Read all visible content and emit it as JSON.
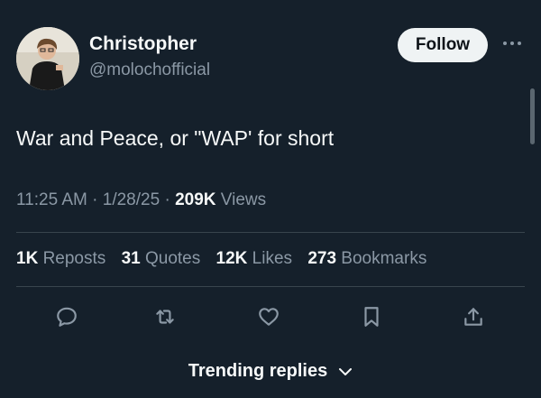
{
  "author": {
    "name": "Christopher",
    "handle": "@molochofficial",
    "follow_label": "Follow"
  },
  "tweet": {
    "text": "War and Peace, or \"WAP' for short",
    "time": "11:25 AM",
    "date": "1/28/25",
    "views_count": "209K",
    "views_label": "Views"
  },
  "stats": {
    "reposts_count": "1K",
    "reposts_label": "Reposts",
    "quotes_count": "31",
    "quotes_label": "Quotes",
    "likes_count": "12K",
    "likes_label": "Likes",
    "bookmarks_count": "273",
    "bookmarks_label": "Bookmarks"
  },
  "actions": [
    "reply-icon",
    "repost-icon",
    "like-icon",
    "bookmark-icon",
    "share-icon"
  ],
  "trending": {
    "label": "Trending replies"
  },
  "colors": {
    "background": "#15202b",
    "text": "#f7f9f9",
    "muted": "#8b98a5",
    "divider": "#38444d"
  }
}
